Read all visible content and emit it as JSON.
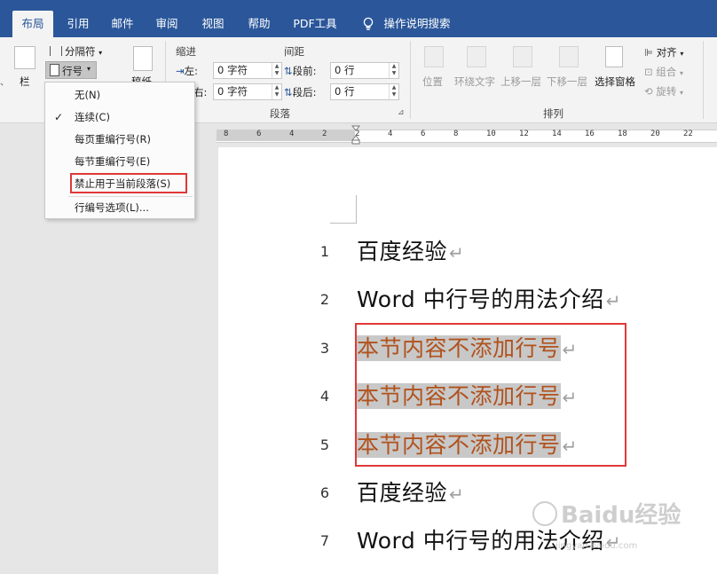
{
  "tabs": [
    "布局",
    "引用",
    "邮件",
    "审阅",
    "视图",
    "帮助",
    "PDF工具",
    "操作说明搜索"
  ],
  "ribbon": {
    "columns_label": "栏",
    "breaks_label": "分隔符",
    "line_numbers_label": "行号",
    "draft_label": "稿纸",
    "indent_title": "缩进",
    "spacing_title": "间距",
    "indent_left_label": "左:",
    "indent_left_value": "0 字符",
    "indent_right_label": "右:",
    "indent_right_value": "0 字符",
    "spacing_before_label": "段前:",
    "spacing_before_value": "0 行",
    "spacing_after_label": "段后:",
    "spacing_after_value": "0 行",
    "paragraph_group": "段落",
    "position": "位置",
    "wrap_text": "环绕文字",
    "bring_forward": "上移一层",
    "send_backward": "下移一层",
    "selection_pane": "选择窗格",
    "align": "对齐",
    "group": "组合",
    "rotate": "旋转",
    "arrange_group": "排列"
  },
  "menu": {
    "items": [
      "无(N)",
      "连续(C)",
      "每页重编行号(R)",
      "每节重编行号(E)",
      "禁止用于当前段落(S)",
      "行编号选项(L)..."
    ],
    "checked_index": 1
  },
  "ruler": {
    "numbers": [
      "8",
      "6",
      "4",
      "2",
      "2",
      "4",
      "6",
      "8",
      "10",
      "12",
      "14",
      "16",
      "18",
      "20",
      "22"
    ]
  },
  "document": {
    "lines": [
      {
        "num": "1",
        "text": "百度经验"
      },
      {
        "num": "2",
        "text": "Word 中行号的用法介绍"
      },
      {
        "num": "3",
        "text": "本节内容不添加行号"
      },
      {
        "num": "4",
        "text": "本节内容不添加行号"
      },
      {
        "num": "5",
        "text": "本节内容不添加行号"
      },
      {
        "num": "6",
        "text": "百度经验"
      },
      {
        "num": "7",
        "text": "Word 中行号的用法介绍"
      }
    ],
    "paragraph_mark": "↵"
  },
  "watermark": {
    "brand": "Baidu经验",
    "url": "jingyan.baidu.com"
  },
  "colors": {
    "ribbon_blue": "#2b579a",
    "highlight_red": "#e03838",
    "text_orange": "#b0521d"
  }
}
